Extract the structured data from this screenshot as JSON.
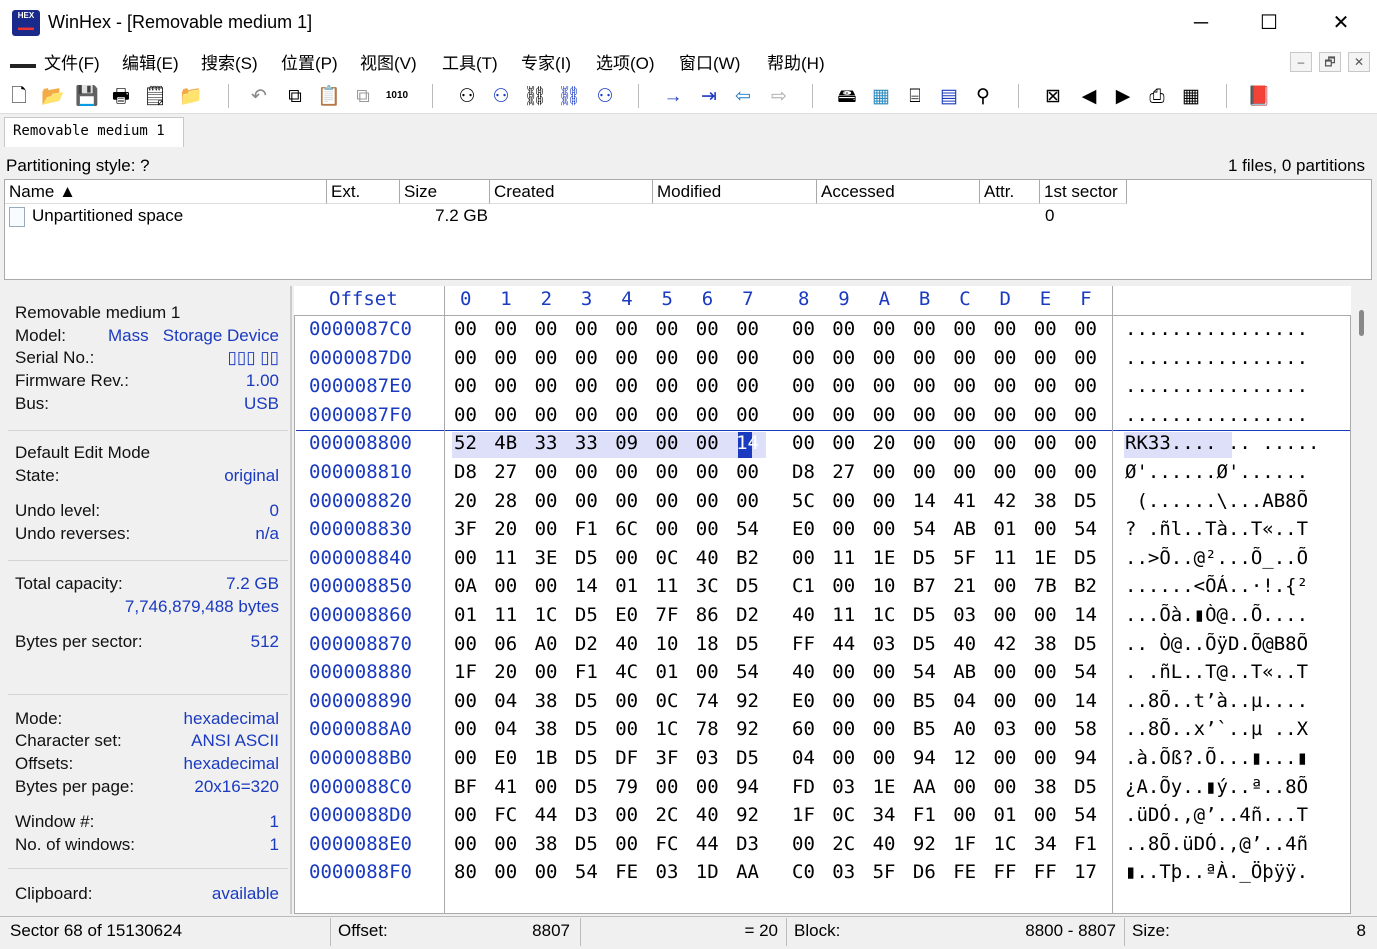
{
  "window": {
    "title": "WinHex - [Removable medium 1]",
    "minimize": "─",
    "maximize": "☐",
    "close": "✕"
  },
  "menu": [
    "文件(F)",
    "编辑(E)",
    "搜索(S)",
    "位置(P)",
    "视图(V)",
    "工具(T)",
    "专家(I)",
    "选项(O)",
    "窗口(W)",
    "帮助(H)"
  ],
  "mdi_buttons": [
    "–",
    "🗗",
    "✕"
  ],
  "toolbar_icons": [
    "new-file-icon",
    "open-folder-icon",
    "save-icon",
    "print-icon",
    "properties-icon",
    "open-disk-icon",
    "undo-icon",
    "copy-icon",
    "paste-icon",
    "copy-block-icon",
    "hex-binary-icon",
    "find-text-icon",
    "find-hex-icon",
    "replace-text-icon",
    "replace-hex-icon",
    "find-next-icon",
    "goto-offset-icon",
    "goto-sector-icon",
    "back-icon",
    "forward-icon",
    "disk-tools-icon",
    "ram-editor-icon",
    "disk-clone-icon",
    "calculator-icon",
    "analyze-icon",
    "disk-map-icon",
    "prev-icon",
    "next-icon",
    "snapshot-icon",
    "data-interpreter-icon",
    "help-book-icon"
  ],
  "tab": {
    "label": "Removable medium 1"
  },
  "partition": {
    "style": "Partitioning style: ?",
    "count": "1 files, 0 partitions"
  },
  "filelist": {
    "columns": [
      "Name ▲",
      "Ext.",
      "Size",
      "Created",
      "Modified",
      "Accessed",
      "Attr.",
      "1st sector"
    ],
    "rows": [
      {
        "name": "Unpartitioned space",
        "ext": "",
        "size": "7.2 GB",
        "created": "",
        "modified": "",
        "accessed": "",
        "attr": "",
        "first_sector": "0"
      }
    ]
  },
  "info": {
    "device_title": "Removable medium 1",
    "model_label": "Model:",
    "model_value": "Mass   Storage Device",
    "serial_label": "Serial No.:",
    "serial_value": "▯▯▯ ▯▯",
    "firmware_label": "Firmware Rev.:",
    "firmware_value": "1.00",
    "bus_label": "Bus:",
    "bus_value": "USB",
    "edit_mode": "Default Edit Mode",
    "state_label": "State:",
    "state_value": "original",
    "undo_level_label": "Undo level:",
    "undo_level_value": "0",
    "undo_rev_label": "Undo reverses:",
    "undo_rev_value": "n/a",
    "capacity_label": "Total capacity:",
    "capacity_value": "7.2 GB",
    "capacity_bytes": "7,746,879,488 bytes",
    "bps_label": "Bytes per sector:",
    "bps_value": "512",
    "mode_label": "Mode:",
    "mode_value": "hexadecimal",
    "charset_label": "Character set:",
    "charset_value": "ANSI ASCII",
    "offsets_label": "Offsets:",
    "offsets_value": "hexadecimal",
    "bpp_label": "Bytes per page:",
    "bpp_value": "20x16=320",
    "window_label": "Window #:",
    "window_value": "1",
    "nwin_label": "No. of windows:",
    "nwin_value": "1",
    "clipboard_label": "Clipboard:",
    "clipboard_value": "available"
  },
  "hex": {
    "offset_header": "Offset",
    "col_headers": [
      "0",
      "1",
      "2",
      "3",
      "4",
      "5",
      "6",
      "7",
      "8",
      "9",
      "A",
      "B",
      "C",
      "D",
      "E",
      "F"
    ],
    "rows": [
      {
        "offset": "0000087C0",
        "bytes": [
          "00",
          "00",
          "00",
          "00",
          "00",
          "00",
          "00",
          "00",
          "00",
          "00",
          "00",
          "00",
          "00",
          "00",
          "00",
          "00"
        ],
        "ascii": "................"
      },
      {
        "offset": "0000087D0",
        "bytes": [
          "00",
          "00",
          "00",
          "00",
          "00",
          "00",
          "00",
          "00",
          "00",
          "00",
          "00",
          "00",
          "00",
          "00",
          "00",
          "00"
        ],
        "ascii": "................"
      },
      {
        "offset": "0000087E0",
        "bytes": [
          "00",
          "00",
          "00",
          "00",
          "00",
          "00",
          "00",
          "00",
          "00",
          "00",
          "00",
          "00",
          "00",
          "00",
          "00",
          "00"
        ],
        "ascii": "................"
      },
      {
        "offset": "0000087F0",
        "bytes": [
          "00",
          "00",
          "00",
          "00",
          "00",
          "00",
          "00",
          "00",
          "00",
          "00",
          "00",
          "00",
          "00",
          "00",
          "00",
          "00"
        ],
        "ascii": "................"
      },
      {
        "offset": "000008800",
        "bytes": [
          "52",
          "4B",
          "33",
          "33",
          "09",
          "00",
          "00",
          "14",
          "00",
          "00",
          "20",
          "00",
          "00",
          "00",
          "00",
          "00"
        ],
        "ascii": "RK33.... .. ....."
      },
      {
        "offset": "000008810",
        "bytes": [
          "D8",
          "27",
          "00",
          "00",
          "00",
          "00",
          "00",
          "00",
          "D8",
          "27",
          "00",
          "00",
          "00",
          "00",
          "00",
          "00"
        ],
        "ascii": "Ø'......Ø'......"
      },
      {
        "offset": "000008820",
        "bytes": [
          "20",
          "28",
          "00",
          "00",
          "00",
          "00",
          "00",
          "00",
          "5C",
          "00",
          "00",
          "14",
          "41",
          "42",
          "38",
          "D5"
        ],
        "ascii": " (......\\...AB8Õ"
      },
      {
        "offset": "000008830",
        "bytes": [
          "3F",
          "20",
          "00",
          "F1",
          "6C",
          "00",
          "00",
          "54",
          "E0",
          "00",
          "00",
          "54",
          "AB",
          "01",
          "00",
          "54"
        ],
        "ascii": "? .ñl..Tà..T«..T"
      },
      {
        "offset": "000008840",
        "bytes": [
          "00",
          "11",
          "3E",
          "D5",
          "00",
          "0C",
          "40",
          "B2",
          "00",
          "11",
          "1E",
          "D5",
          "5F",
          "11",
          "1E",
          "D5"
        ],
        "ascii": "..>Õ..@²...Õ_..Õ"
      },
      {
        "offset": "000008850",
        "bytes": [
          "0A",
          "00",
          "00",
          "14",
          "01",
          "11",
          "3C",
          "D5",
          "C1",
          "00",
          "10",
          "B7",
          "21",
          "00",
          "7B",
          "B2"
        ],
        "ascii": "......<ÕÁ..·!.{²"
      },
      {
        "offset": "000008860",
        "bytes": [
          "01",
          "11",
          "1C",
          "D5",
          "E0",
          "7F",
          "86",
          "D2",
          "40",
          "11",
          "1C",
          "D5",
          "03",
          "00",
          "00",
          "14"
        ],
        "ascii": "...Õà.▮Ò@..Õ...."
      },
      {
        "offset": "000008870",
        "bytes": [
          "00",
          "06",
          "A0",
          "D2",
          "40",
          "10",
          "18",
          "D5",
          "FF",
          "44",
          "03",
          "D5",
          "40",
          "42",
          "38",
          "D5"
        ],
        "ascii": ".. Ò@..ÕÿD.Õ@B8Õ"
      },
      {
        "offset": "000008880",
        "bytes": [
          "1F",
          "20",
          "00",
          "F1",
          "4C",
          "01",
          "00",
          "54",
          "40",
          "00",
          "00",
          "54",
          "AB",
          "00",
          "00",
          "54"
        ],
        "ascii": ". .ñL..T@..T«..T"
      },
      {
        "offset": "000008890",
        "bytes": [
          "00",
          "04",
          "38",
          "D5",
          "00",
          "0C",
          "74",
          "92",
          "E0",
          "00",
          "00",
          "B5",
          "04",
          "00",
          "00",
          "14"
        ],
        "ascii": "..8Õ..t’à..µ...."
      },
      {
        "offset": "0000088A0",
        "bytes": [
          "00",
          "04",
          "38",
          "D5",
          "00",
          "1C",
          "78",
          "92",
          "60",
          "00",
          "00",
          "B5",
          "A0",
          "03",
          "00",
          "58"
        ],
        "ascii": "..8Õ..x’`..µ ..X"
      },
      {
        "offset": "0000088B0",
        "bytes": [
          "00",
          "E0",
          "1B",
          "D5",
          "DF",
          "3F",
          "03",
          "D5",
          "04",
          "00",
          "00",
          "94",
          "12",
          "00",
          "00",
          "94"
        ],
        "ascii": ".à.Õß?.Õ...▮...▮"
      },
      {
        "offset": "0000088C0",
        "bytes": [
          "BF",
          "41",
          "00",
          "D5",
          "79",
          "00",
          "00",
          "94",
          "FD",
          "03",
          "1E",
          "AA",
          "00",
          "00",
          "38",
          "D5"
        ],
        "ascii": "¿A.Õy..▮ý..ª..8Õ"
      },
      {
        "offset": "0000088D0",
        "bytes": [
          "00",
          "FC",
          "44",
          "D3",
          "00",
          "2C",
          "40",
          "92",
          "1F",
          "0C",
          "34",
          "F1",
          "00",
          "01",
          "00",
          "54"
        ],
        "ascii": ".üDÓ.,@’..4ñ...T"
      },
      {
        "offset": "0000088E0",
        "bytes": [
          "00",
          "00",
          "38",
          "D5",
          "00",
          "FC",
          "44",
          "D3",
          "00",
          "2C",
          "40",
          "92",
          "1F",
          "1C",
          "34",
          "F1"
        ],
        "ascii": "..8Õ.üDÓ.,@’..4ñ"
      },
      {
        "offset": "0000088F0",
        "bytes": [
          "80",
          "00",
          "00",
          "54",
          "FE",
          "03",
          "1D",
          "AA",
          "C0",
          "03",
          "5F",
          "D6",
          "FE",
          "FF",
          "FF",
          "17"
        ],
        "ascii": "▮..Tþ..ªÀ._Öþÿÿ."
      }
    ]
  },
  "status": {
    "sector": "Sector 68 of 15130624",
    "offset_label": "Offset:",
    "offset_value": "8807",
    "value": "= 20",
    "block_label": "Block:",
    "block_value": "8800 - 8807",
    "size_label": "Size:",
    "size_value": "8"
  }
}
